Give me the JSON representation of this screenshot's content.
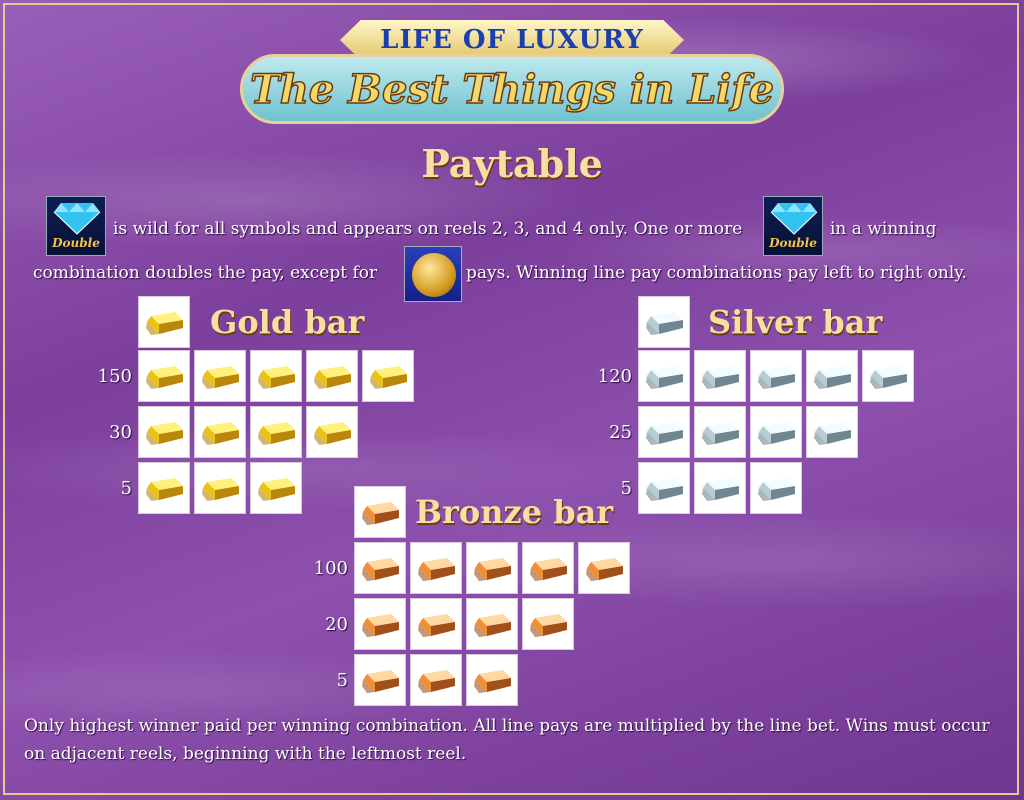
{
  "logo": {
    "top": "LIFE OF LUXURY",
    "main": "The Best Things in Life"
  },
  "title": "Paytable",
  "rules": {
    "line1_a": "is wild for all symbols and appears on reels 2, 3, and 4 only. One or more",
    "line1_b": "in a winning",
    "line2_a": "combination doubles the pay, except for",
    "line2_b": "pays. Winning line pay combinations pay left to right only.",
    "wild_symbol_text": "Double",
    "wild_icon": "double-diamond-icon",
    "excluded_icon": "gold-coin-icon"
  },
  "symbols": [
    {
      "key": "gold",
      "title": "Gold  bar",
      "icon": "gold-bar-icon",
      "colors": [
        "#fff27a",
        "#e9c21a",
        "#b8870b"
      ],
      "pays": [
        {
          "count": 5,
          "value": "150"
        },
        {
          "count": 4,
          "value": "30"
        },
        {
          "count": 3,
          "value": "5"
        }
      ]
    },
    {
      "key": "silver",
      "title": "Silver  bar",
      "icon": "silver-bar-icon",
      "colors": [
        "#f2fbff",
        "#b7cdd6",
        "#6f8791"
      ],
      "pays": [
        {
          "count": 5,
          "value": "120"
        },
        {
          "count": 4,
          "value": "25"
        },
        {
          "count": 3,
          "value": "5"
        }
      ]
    },
    {
      "key": "bronze",
      "title": "Bronze  bar",
      "icon": "bronze-bar-icon",
      "colors": [
        "#ffd7a0",
        "#ee8f3a",
        "#a2501a"
      ],
      "pays": [
        {
          "count": 5,
          "value": "100"
        },
        {
          "count": 4,
          "value": "20"
        },
        {
          "count": 3,
          "value": "5"
        }
      ]
    }
  ],
  "footer": "Only highest winner paid per winning combination. All line pays are multiplied by the line bet. Wins must occur on adjacent reels, beginning with the leftmost reel."
}
